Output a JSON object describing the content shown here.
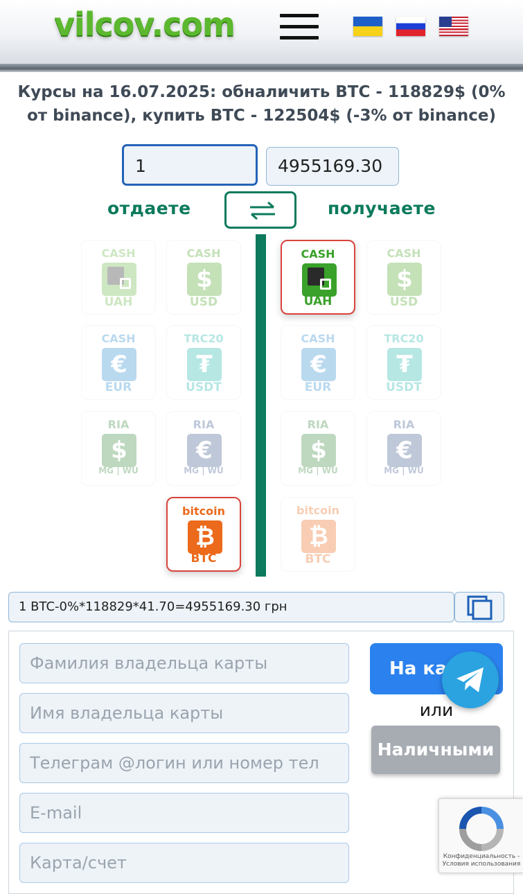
{
  "header": {
    "logo": "vilcov.com",
    "menu_icon": "hamburger-menu-icon",
    "languages": [
      "UA",
      "RU",
      "US"
    ]
  },
  "rates_text": "Курсы на 16.07.2025: обналичить BTC - 118829$ (0% от binance), купить BTC - 122504$ (-3% от binance)",
  "exchange": {
    "give_amount": "1",
    "get_amount": "4955169.30",
    "give_label": "отдаете",
    "get_label": "получаете",
    "swap_icon": "swap-arrows-icon"
  },
  "give_currencies": [
    {
      "top": "CASH",
      "icon": "mono",
      "bottom": "UAH",
      "color": "#6ab84a"
    },
    {
      "top": "CASH",
      "icon": "$",
      "bottom": "USD",
      "color": "#4fa52c"
    },
    {
      "top": "CASH",
      "icon": "€",
      "bottom": "EUR",
      "color": "#2f8fd1"
    },
    {
      "top": "TRC20",
      "icon": "₮",
      "bottom": "USDT",
      "color": "#26b7ad"
    },
    {
      "top": "RIA",
      "icon": "$",
      "bottom": "MG | WU",
      "color": "#3b8a3f"
    },
    {
      "top": "RIA",
      "icon": "€",
      "bottom": "MG | WU",
      "color": "#3f5c8e"
    },
    {
      "top": "bitcoin",
      "icon": "₿",
      "bottom": "BTC",
      "color": "#ec6a1c"
    }
  ],
  "get_currencies": [
    {
      "top": "CASH",
      "icon": "mono",
      "bottom": "UAH",
      "color": "#3aa12a"
    },
    {
      "top": "CASH",
      "icon": "$",
      "bottom": "USD",
      "color": "#4fa52c"
    },
    {
      "top": "CASH",
      "icon": "€",
      "bottom": "EUR",
      "color": "#2f8fd1"
    },
    {
      "top": "TRC20",
      "icon": "₮",
      "bottom": "USDT",
      "color": "#26b7ad"
    },
    {
      "top": "RIA",
      "icon": "$",
      "bottom": "MG | WU",
      "color": "#3b8a3f"
    },
    {
      "top": "RIA",
      "icon": "€",
      "bottom": "MG | WU",
      "color": "#3f5c8e"
    },
    {
      "top": "bitcoin",
      "icon": "₿",
      "bottom": "BTC",
      "color": "#ec6a1c"
    }
  ],
  "selected": {
    "give": "BTC",
    "get": "UAH"
  },
  "calculation": "1 BTC-0%*118829*41.70=4955169.30 грн",
  "form": {
    "surname_placeholder": "Фамилия владельца карты",
    "name_placeholder": "Имя владельца карты",
    "telegram_placeholder": "Телеграм @логин или номер тел",
    "email_placeholder": "E-mail",
    "card_placeholder": "Карта/счет"
  },
  "buttons": {
    "to_card": "На карту",
    "or": "или",
    "cash": "Наличными"
  },
  "recaptcha": {
    "text": "Конфиденциальность - Условия использования"
  },
  "colors": {
    "accent_green": "#0c7a5c",
    "primary_blue": "#2b82ee",
    "selected_border": "#d9433b"
  }
}
